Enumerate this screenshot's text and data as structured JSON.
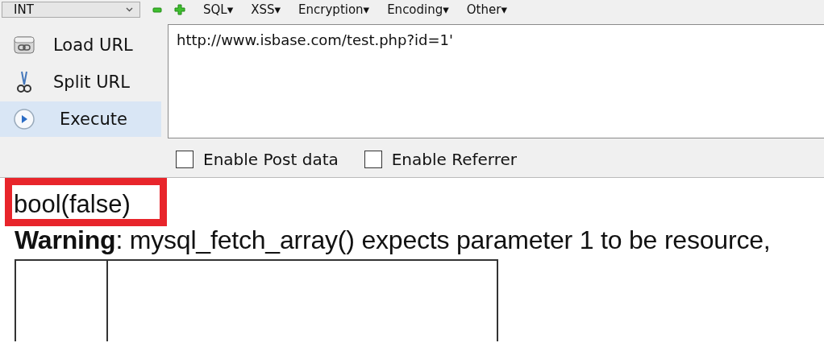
{
  "toolbar": {
    "dropdown": {
      "value": "INT"
    },
    "menus": [
      {
        "label": "SQL▾"
      },
      {
        "label": "XSS▾"
      },
      {
        "label": "Encryption▾"
      },
      {
        "label": "Encoding▾"
      },
      {
        "label": "Other▾"
      }
    ]
  },
  "sidebar": {
    "items": [
      {
        "kind": "load",
        "label": "Load URL",
        "selected": false
      },
      {
        "kind": "split",
        "label": "Split URL",
        "selected": false
      },
      {
        "kind": "execute",
        "label": "Execute",
        "selected": true
      }
    ]
  },
  "url_field": {
    "value": "http://www.isbase.com/test.php?id=1'"
  },
  "options": [
    {
      "label": "Enable Post data",
      "checked": false
    },
    {
      "label": "Enable Referrer",
      "checked": false
    }
  ],
  "output": {
    "result": {
      "text": "bool(false)",
      "highlighted": true
    },
    "warning": "**Warning**: mysql_fetch_array() expects parameter 1 to be resource,",
    "table": {
      "cells": [
        {
          "kind": "narrow"
        },
        {
          "kind": "wide"
        }
      ]
    }
  }
}
